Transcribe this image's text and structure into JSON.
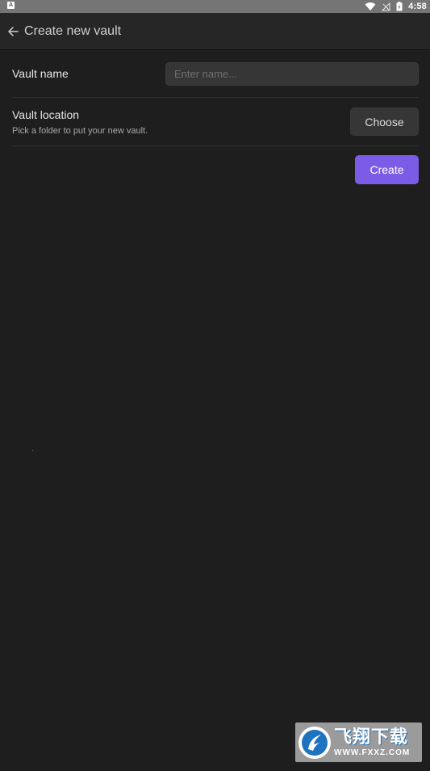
{
  "status_bar": {
    "indicator": "A",
    "time": "4:58",
    "icons": [
      "wifi-icon",
      "signal-icon",
      "battery-icon"
    ]
  },
  "header": {
    "back_icon": "arrow-left-icon",
    "title": "Create new vault"
  },
  "form": {
    "name": {
      "label": "Vault name",
      "value": "",
      "placeholder": "Enter name..."
    },
    "location": {
      "label": "Vault location",
      "description": "Pick a folder to put your new vault.",
      "button_label": "Choose"
    },
    "create_label": "Create"
  },
  "colors": {
    "background": "#1e1e1e",
    "header": "#262626",
    "accent": "#7c5ce7",
    "input": "#363636"
  },
  "watermark": {
    "title": "飞翔下载",
    "url": "WWW.FXXZ.COM"
  }
}
